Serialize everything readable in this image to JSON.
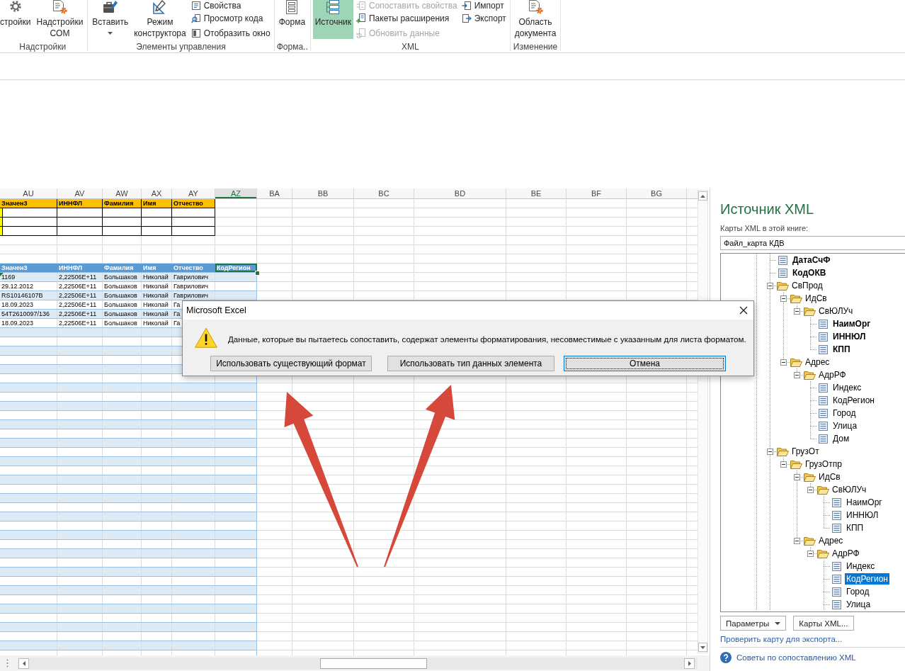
{
  "ribbon": {
    "groups": [
      {
        "label": "Надстройки",
        "controls": [
          {
            "kind": "large",
            "label": "стройки",
            "pressed": false,
            "dropdown": false
          },
          {
            "kind": "large",
            "label": "Надстройки COM",
            "pressed": false,
            "dropdown": false
          }
        ]
      },
      {
        "label": "Элементы управления",
        "controls": [
          {
            "kind": "large",
            "label": "Вставить",
            "pressed": false,
            "dropdown": true
          },
          {
            "kind": "large",
            "label": "Режим конструктора",
            "pressed": false,
            "dropdown": false
          },
          {
            "kind": "stack",
            "buttons": [
              {
                "label": "Свойства",
                "disabled": false
              },
              {
                "label": "Просмотр кода",
                "disabled": false
              },
              {
                "label": "Отобразить окно",
                "disabled": false
              }
            ]
          }
        ]
      },
      {
        "label": "Форма..",
        "controls": [
          {
            "kind": "large",
            "label": "Форма",
            "pressed": false,
            "dropdown": false
          }
        ]
      },
      {
        "label": "XML",
        "controls": [
          {
            "kind": "large",
            "label": "Источник",
            "pressed": true,
            "dropdown": false
          },
          {
            "kind": "stack",
            "buttons": [
              {
                "label": "Сопоставить свойства",
                "disabled": true
              },
              {
                "label": "Пакеты расширения",
                "disabled": false
              },
              {
                "label": "Обновить данные",
                "disabled": true
              }
            ]
          },
          {
            "kind": "stack",
            "buttons": [
              {
                "label": "Импорт",
                "disabled": false
              },
              {
                "label": "Экспорт",
                "disabled": false
              }
            ]
          }
        ]
      },
      {
        "label": "Изменение",
        "controls": [
          {
            "kind": "large",
            "label": "Область документа",
            "pressed": false,
            "dropdown": false
          }
        ]
      }
    ]
  },
  "sheet": {
    "columns": [
      {
        "label": "AU",
        "selected": false
      },
      {
        "label": "AV",
        "selected": false
      },
      {
        "label": "AW",
        "selected": false
      },
      {
        "label": "AX",
        "selected": false
      },
      {
        "label": "AY",
        "selected": false
      },
      {
        "label": "AZ",
        "selected": true
      },
      {
        "label": "BA",
        "selected": false
      },
      {
        "label": "BB",
        "selected": false
      },
      {
        "label": "BC",
        "selected": false
      },
      {
        "label": "BD",
        "selected": false
      },
      {
        "label": "BE",
        "selected": false
      },
      {
        "label": "BF",
        "selected": false
      },
      {
        "label": "BG",
        "selected": false
      }
    ],
    "tables": [
      {
        "kind": "plain",
        "columns": [
          "Значен3",
          "ИННФЛ",
          "Фамилия",
          "Имя",
          "Отчество"
        ]
      },
      {
        "kind": "banded",
        "columns": [
          {
            "label": "Значен3",
            "selected": false
          },
          {
            "label": "ИННФЛ",
            "selected": false
          },
          {
            "label": "Фамилия",
            "selected": false
          },
          {
            "label": "Имя",
            "selected": false
          },
          {
            "label": "Отчество",
            "selected": false
          },
          {
            "label": "КодРегион",
            "selected": true
          }
        ],
        "rows": [
          {
            "cells": [
              "1169",
              "2,22506E+11",
              "Большаков",
              "Николай",
              "Гаврилович"
            ],
            "flagged": true
          },
          {
            "cells": [
              "29.12.2012",
              "2,22506E+11",
              "Большаков",
              "Николай",
              "Гаврилович"
            ],
            "flagged": false
          },
          {
            "cells": [
              "RS10146107B",
              "2,22506E+11",
              "Большаков",
              "Николай",
              "Гаврилович"
            ],
            "flagged": false
          },
          {
            "cells": [
              "18.09.2023",
              "2,22506E+11",
              "Большаков",
              "Николай",
              "Га"
            ],
            "flagged": false
          },
          {
            "cells": [
              "54T2610097/136",
              "2,22506E+11",
              "Большаков",
              "Николай",
              "Га"
            ],
            "flagged": false
          },
          {
            "cells": [
              "18.09.2023",
              "2,22506E+11",
              "Большаков",
              "Николай",
              "Га"
            ],
            "flagged": false
          }
        ]
      }
    ]
  },
  "dialog": {
    "title": "Microsoft Excel",
    "message": "Данные, которые вы пытаетесь сопоставить, содержат элементы форматирования, несовместимые с указанным для листа форматом.",
    "buttons": [
      {
        "label": "Использовать существующий формат",
        "default": false
      },
      {
        "label": "Использовать тип данных элемента",
        "default": false
      },
      {
        "label": "Отмена",
        "default": true
      }
    ]
  },
  "xml_source": {
    "title": "Источник XML",
    "maps_label": "Карты XML в этой книге:",
    "map_value": "Файл_карта КДВ",
    "tree": [
      {
        "label": "ДатаСчФ",
        "kind": "element",
        "bold": true,
        "selected": false
      },
      {
        "label": "КодОКВ",
        "kind": "element",
        "bold": true,
        "selected": false
      },
      {
        "label": "СвПрод",
        "kind": "folder",
        "bold": false,
        "selected": false,
        "expanded": true,
        "children": [
          {
            "label": "ИдСв",
            "kind": "folder",
            "bold": false,
            "selected": false,
            "expanded": true,
            "children": [
              {
                "label": "СвЮЛУч",
                "kind": "folder",
                "bold": false,
                "selected": false,
                "expanded": true,
                "children": [
                  {
                    "label": "НаимОрг",
                    "kind": "element",
                    "bold": true,
                    "selected": false
                  },
                  {
                    "label": "ИННЮЛ",
                    "kind": "element",
                    "bold": true,
                    "selected": false
                  },
                  {
                    "label": "КПП",
                    "kind": "element",
                    "bold": true,
                    "selected": false
                  }
                ]
              }
            ]
          },
          {
            "label": "Адрес",
            "kind": "folder",
            "bold": false,
            "selected": false,
            "expanded": true,
            "children": [
              {
                "label": "АдрРФ",
                "kind": "folder",
                "bold": false,
                "selected": false,
                "expanded": true,
                "children": [
                  {
                    "label": "Индекс",
                    "kind": "element",
                    "bold": false,
                    "selected": false
                  },
                  {
                    "label": "КодРегион",
                    "kind": "element",
                    "bold": false,
                    "selected": false
                  },
                  {
                    "label": "Город",
                    "kind": "element",
                    "bold": false,
                    "selected": false
                  },
                  {
                    "label": "Улица",
                    "kind": "element",
                    "bold": false,
                    "selected": false
                  },
                  {
                    "label": "Дом",
                    "kind": "element",
                    "bold": false,
                    "selected": false
                  }
                ]
              }
            ]
          }
        ]
      },
      {
        "label": "ГрузОт",
        "kind": "folder",
        "bold": false,
        "selected": false,
        "expanded": true,
        "children": [
          {
            "label": "ГрузОтпр",
            "kind": "folder",
            "bold": false,
            "selected": false,
            "expanded": true,
            "children": [
              {
                "label": "ИдСв",
                "kind": "folder",
                "bold": false,
                "selected": false,
                "expanded": true,
                "children": [
                  {
                    "label": "СвЮЛУч",
                    "kind": "folder",
                    "bold": false,
                    "selected": false,
                    "expanded": true,
                    "children": [
                      {
                        "label": "НаимОрг",
                        "kind": "element",
                        "bold": false,
                        "selected": false
                      },
                      {
                        "label": "ИННЮЛ",
                        "kind": "element",
                        "bold": false,
                        "selected": false
                      },
                      {
                        "label": "КПП",
                        "kind": "element",
                        "bold": false,
                        "selected": false
                      }
                    ]
                  }
                ]
              },
              {
                "label": "Адрес",
                "kind": "folder",
                "bold": false,
                "selected": false,
                "expanded": true,
                "children": [
                  {
                    "label": "АдрРФ",
                    "kind": "folder",
                    "bold": false,
                    "selected": false,
                    "expanded": true,
                    "children": [
                      {
                        "label": "Индекс",
                        "kind": "element",
                        "bold": false,
                        "selected": false
                      },
                      {
                        "label": "КодРегион",
                        "kind": "element",
                        "bold": false,
                        "selected": true
                      },
                      {
                        "label": "Город",
                        "kind": "element",
                        "bold": false,
                        "selected": false
                      },
                      {
                        "label": "Улица",
                        "kind": "element",
                        "bold": false,
                        "selected": false
                      }
                    ]
                  }
                ]
              }
            ]
          }
        ]
      }
    ],
    "buttons": [
      {
        "label": "Параметры",
        "dropdown": true
      },
      {
        "label": "Карты XML...",
        "dropdown": false
      }
    ],
    "verify_link": "Проверить карту для экспорта...",
    "help_link": "Советы по сопоставлению XML"
  },
  "annotations": [
    {
      "kind": "arrow"
    },
    {
      "kind": "arrow"
    }
  ]
}
